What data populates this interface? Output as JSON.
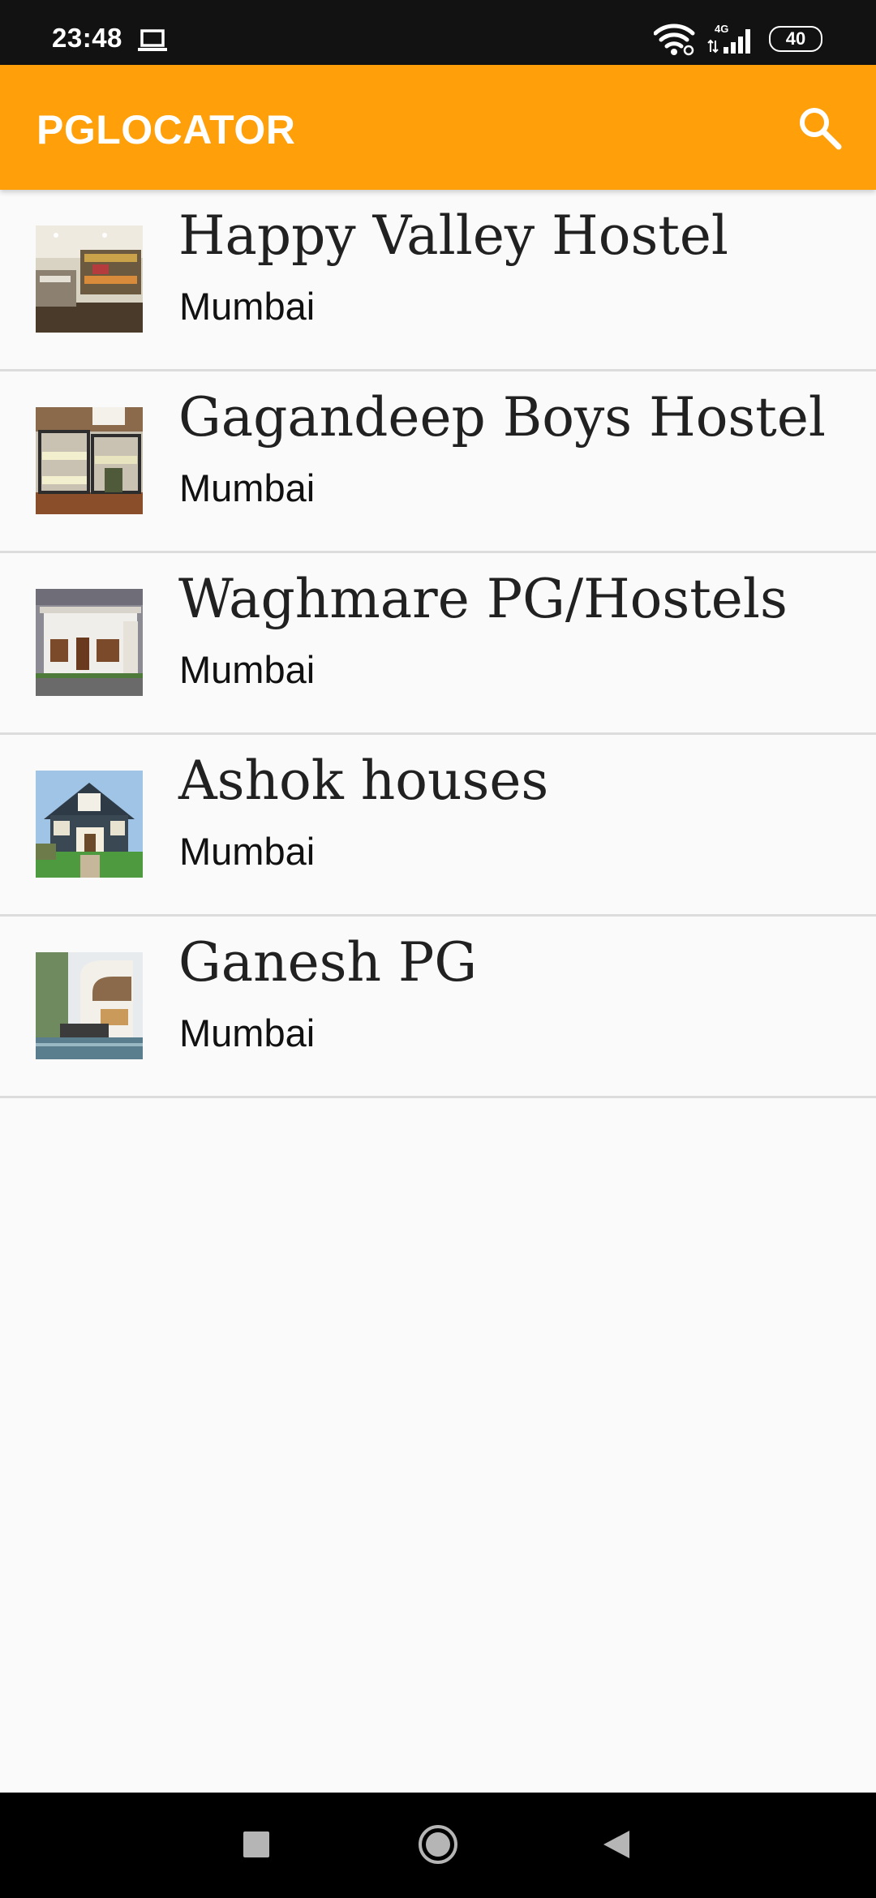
{
  "status_bar": {
    "time": "23:48",
    "network_type": "4G",
    "battery_level": "40",
    "icons": [
      "laptop-icon",
      "wifi-icon",
      "signal-icon",
      "battery-icon"
    ]
  },
  "app_bar": {
    "title": "PGLOCATOR",
    "background_color": "#ff9f0a",
    "search_icon": "search-icon"
  },
  "listings": [
    {
      "name": "Happy Valley Hostel",
      "city": "Mumbai"
    },
    {
      "name": "Gagandeep Boys Hostel",
      "city": "Mumbai"
    },
    {
      "name": "Waghmare PG/Hostels",
      "city": "Mumbai"
    },
    {
      "name": "Ashok houses",
      "city": "Mumbai"
    },
    {
      "name": "Ganesh PG",
      "city": "Mumbai"
    }
  ],
  "nav_bar": {
    "icons": [
      "recents-icon",
      "home-icon",
      "back-icon"
    ]
  }
}
